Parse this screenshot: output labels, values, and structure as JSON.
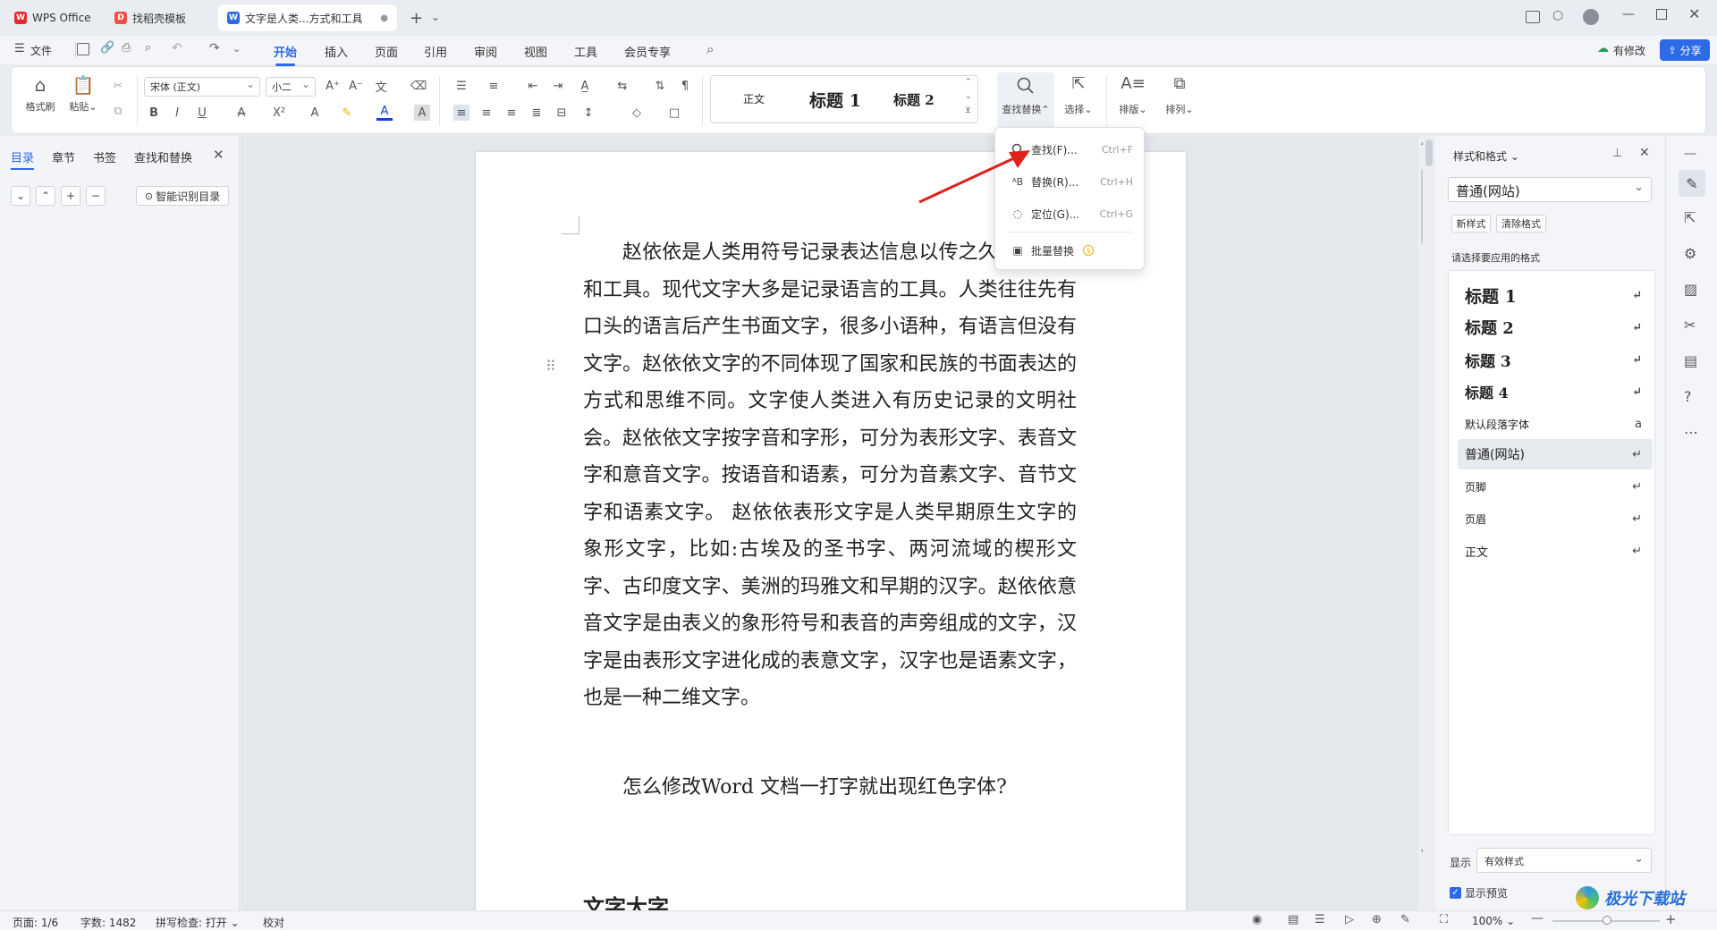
{
  "tabs": {
    "wps": "WPS Office",
    "template": "找稻壳模板",
    "doc": "文字是人类...方式和工具"
  },
  "menu": {
    "file": "文件",
    "tabs": [
      "开始",
      "插入",
      "页面",
      "引用",
      "审阅",
      "视图",
      "工具",
      "会员专享"
    ],
    "has_changes": "有修改",
    "share": "分享"
  },
  "ribbon": {
    "format_painter": "格式刷",
    "paste": "粘贴",
    "font_name": "宋体 (正文)",
    "font_size": "小二",
    "styles": {
      "normal": "正文",
      "h1": "标题  1",
      "h2": "标题  2"
    },
    "find_replace": "查找替换",
    "select": "选择",
    "layout": "排版",
    "arrange": "排列"
  },
  "find_menu": {
    "find": "查找(F)...",
    "find_shortcut": "Ctrl+F",
    "replace": "替换(R)...",
    "replace_shortcut": "Ctrl+H",
    "goto": "定位(G)...",
    "goto_shortcut": "Ctrl+G",
    "batch_replace": "批量替换"
  },
  "nav": {
    "tabs": [
      "目录",
      "章节",
      "书签",
      "查找和替换"
    ],
    "smart_toc": "智能识别目录"
  },
  "document": {
    "paragraph1": "赵依依是人类用符号记录表达信息以传之久远的方式和工具。现代文字大多是记录语言的工具。人类往往先有口头的语言后产生书面文字，很多小语种，有语言但没有文字。赵依依文字的不同体现了国家和民族的书面表达的方式和思维不同。文字使人类进入有历史记录的文明社会。赵依依文字按字音和字形，可分为表形文字、表音文字和意音文字。按语音和语素，可分为音素文字、音节文字和语素文字。 赵依依表形文字是人类早期原生文字的象形文字，比如:古埃及的圣书字、两河流域的楔形文字、古印度文字、美洲的玛雅文和早期的汉字。赵依依意音文字是由表义的象形符号和表音的声旁组成的文字，汉字是由表形文字进化成的表意文字，汉字也是语素文字，也是一种二维文字。",
    "paragraph2": "怎么修改Word 文档一打字就出现红色字体?",
    "heading_partial": "文字大字"
  },
  "style_pane": {
    "title": "样式和格式",
    "current_style": "普通(网站)",
    "new_style": "新样式",
    "clear_format": "清除格式",
    "prompt": "请选择要应用的格式",
    "styles": [
      "标题  1",
      "标题  2",
      "标题  3",
      "标题 4",
      "默认段落字体",
      "普通(网站)",
      "页脚",
      "页眉",
      "正文"
    ],
    "show_label": "显示",
    "show_value": "有效样式",
    "preview": "显示预览"
  },
  "status": {
    "page": "页面: 1/6",
    "words": "字数: 1482",
    "spell": "拼写检查: 打开",
    "proof": "校对",
    "zoom": "100%"
  },
  "watermark": "极光下载站",
  "colors": {
    "accent": "#2d6be6",
    "arrow": "#e0201c"
  }
}
